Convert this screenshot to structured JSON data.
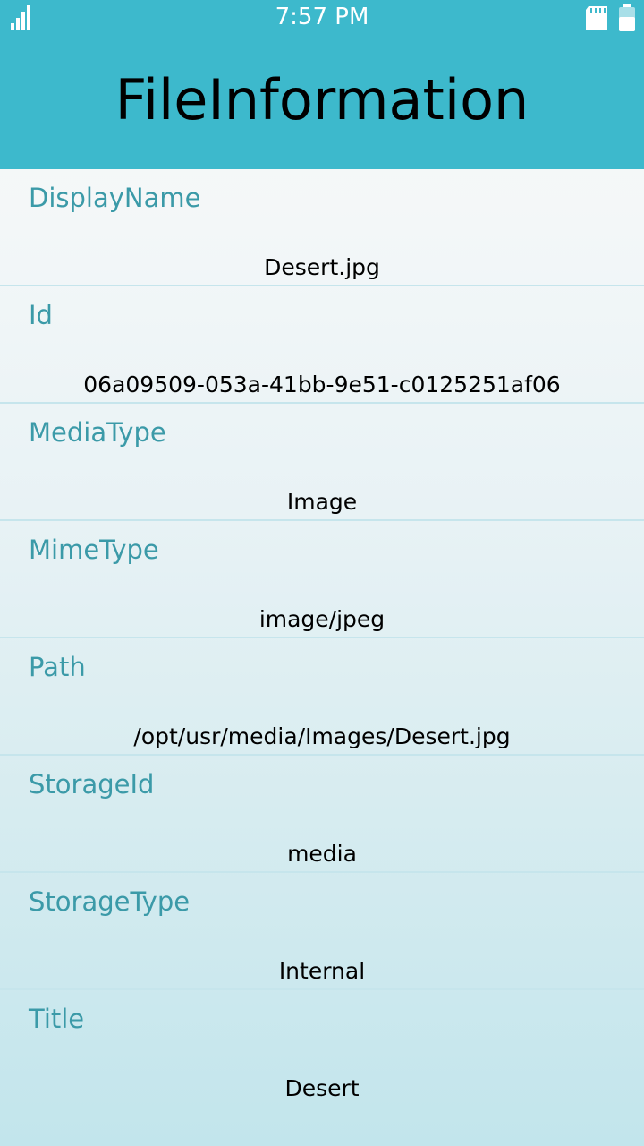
{
  "status_bar": {
    "time": "7:57 PM",
    "icons": [
      "signal-icon",
      "sd-card-icon",
      "battery-icon"
    ],
    "color": "#3db9cc"
  },
  "header": {
    "title": "FileInformation",
    "background": "#3db9cc"
  },
  "rows": [
    {
      "label": "DisplayName",
      "value": "Desert.jpg"
    },
    {
      "label": "Id",
      "value": "06a09509-053a-41bb-9e51-c0125251af06"
    },
    {
      "label": "MediaType",
      "value": "Image"
    },
    {
      "label": "MimeType",
      "value": "image/jpeg"
    },
    {
      "label": "Path",
      "value": "/opt/usr/media/Images/Desert.jpg"
    },
    {
      "label": "StorageId",
      "value": "media"
    },
    {
      "label": "StorageType",
      "value": "Internal"
    },
    {
      "label": "Title",
      "value": "Desert"
    }
  ],
  "colors": {
    "label": "#3b9aa8",
    "value": "#000000",
    "divider": "#c6e5ec"
  }
}
